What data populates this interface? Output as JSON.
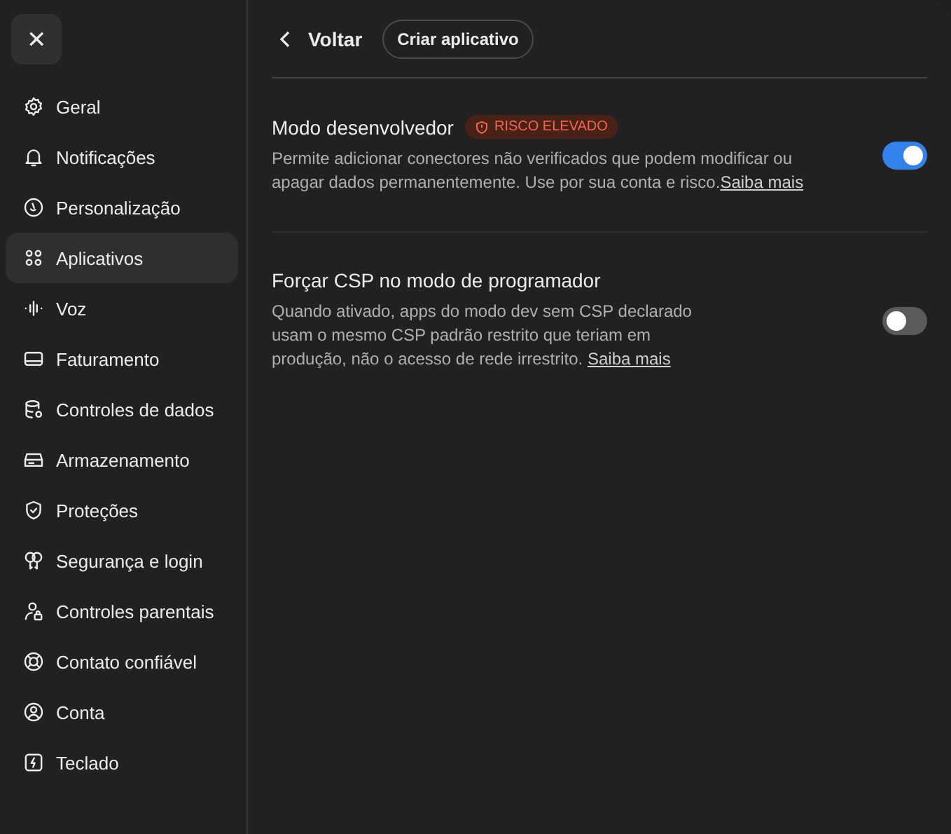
{
  "sidebar": {
    "close_label": "✕",
    "items": [
      {
        "label": "Geral",
        "selected": false
      },
      {
        "label": "Notificações",
        "selected": false
      },
      {
        "label": "Personalização",
        "selected": false
      },
      {
        "label": "Aplicativos",
        "selected": true
      },
      {
        "label": "Voz",
        "selected": false
      },
      {
        "label": "Faturamento",
        "selected": false
      },
      {
        "label": "Controles de dados",
        "selected": false
      },
      {
        "label": "Armazenamento",
        "selected": false
      },
      {
        "label": "Proteções",
        "selected": false
      },
      {
        "label": "Segurança e login",
        "selected": false
      },
      {
        "label": "Controles parentais",
        "selected": false
      },
      {
        "label": "Contato confiável",
        "selected": false
      },
      {
        "label": "Conta",
        "selected": false
      },
      {
        "label": "Teclado",
        "selected": false
      }
    ]
  },
  "header": {
    "back_label": "Voltar",
    "create_button": "Criar aplicativo"
  },
  "settings": [
    {
      "title": "Modo desenvolvedor",
      "badge": "RISCO ELEVADO",
      "description": "Permite adicionar conectores não verificados que podem modificar ou apagar dados permanentemente. Use por sua conta e risco.",
      "link": "Saiba mais",
      "on": true
    },
    {
      "title": "Forçar CSP no modo de programador",
      "description": "Quando ativado, apps do modo dev sem CSP declarado usam o mesmo CSP padrão restrito que teriam em produção, não o acesso de rede irrestrito. ",
      "link": "Saiba mais",
      "on": false
    }
  ]
}
